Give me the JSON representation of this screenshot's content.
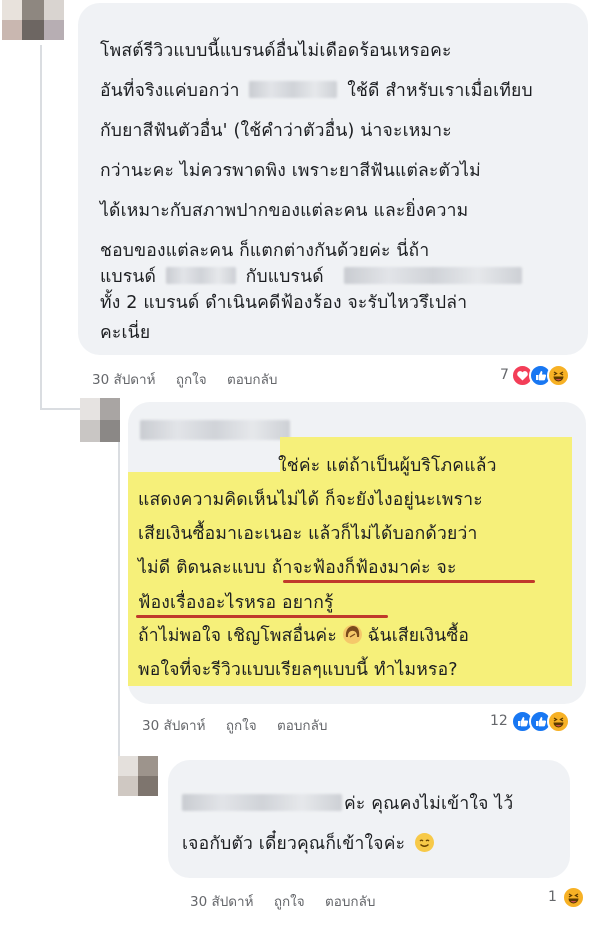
{
  "comments": [
    {
      "lines": [
        "โพสต์รีวิวแบบนี้แบรนด์อื่นไม่เดือดร้อนเหรอคะ",
        "อันที่จริงแค่บอกว่า",
        "ใช้ดี สำหรับเราเมื่อเทียบ",
        "กับยาสีฟันตัวอื่น' (ใช้คำว่าตัวอื่น) น่าจะเหมาะ",
        "กว่านะคะ ไม่ควรพาดพิง เพราะยาสีฟันแต่ละตัวไม่",
        "ได้เหมาะกับสภาพปากของแต่ละคน และยิ่งความ",
        "ชอบของแต่ละคน ก็แตกต่างกันด้วยค่ะ นี่ถ้า",
        "แบรนด์",
        "กับแบรนด์",
        "ทั้ง 2 แบรนด์ ดำเนินคดีฟ้องร้อง จะรับไหวรึเปล่า",
        "คะเนี่ย"
      ],
      "time": "30 สัปดาห์",
      "like": "ถูกใจ",
      "reply": "ตอบกลับ",
      "reaction_count": "7"
    },
    {
      "lines": [
        "ใช่ค่ะ แต่ถ้าเป็นผู้บริโภคแล้ว",
        "แสดงความคิดเห็นไม่ได้ ก็จะยังไงอยู่นะเพราะ",
        "เสียเงินซื้อมาเอะเนอะ แล้วก็ไม่ได้บอกด้วยว่า",
        "ไม่ดี ติดนละแบบ ",
        "ถ้าจะฟ้องก็ฟ้องมาค่ะ จะ",
        "ฟ้องเรื่องอะไรหรอ อยากรู้",
        "ถ้าไม่พอใจ เชิญโพสอื่นค่ะ",
        " ฉันเสียเงินซื้อ",
        "พอใจที่จะรีวิวแบบเรียลๆแบบนี้ ทำไมหรอ?"
      ],
      "time": "30 สัปดาห์",
      "like": "ถูกใจ",
      "reply": "ตอบกลับ",
      "reaction_count": "12"
    },
    {
      "lines": [
        "ค่ะ คุณคงไม่เข้าใจ ไว้",
        "เจอกับตัว เดี๋ยวคุณก็เข้าใจค่ะ"
      ],
      "time": "30 สัปดาห์",
      "like": "ถูกใจ",
      "reply": "ตอบกลับ",
      "reaction_count": "1"
    }
  ],
  "colors": {
    "highlight": "#f6f07a",
    "underline": "#c0392b",
    "bubble": "#f0f2f5",
    "meta_text": "#65676b"
  },
  "icons": [
    "love-reaction-icon",
    "like-reaction-icon",
    "haha-reaction-icon",
    "woman-emoji-icon",
    "smile-emoji-icon"
  ]
}
